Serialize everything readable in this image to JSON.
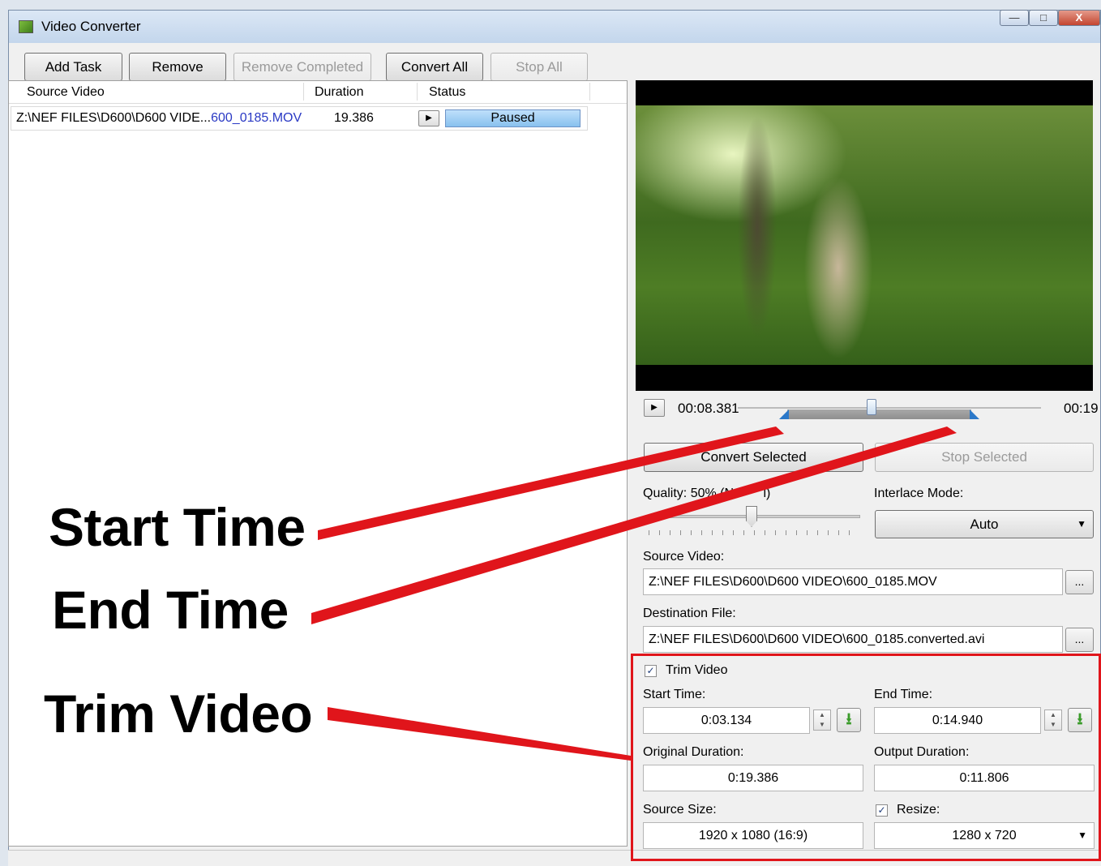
{
  "window": {
    "title": "Video Converter",
    "controls": {
      "minimize": "—",
      "maximize": "□",
      "close": "X"
    }
  },
  "toolbar": {
    "add_task": "Add Task",
    "remove": "Remove",
    "remove_completed": "Remove Completed",
    "convert_all": "Convert All",
    "stop_all": "Stop All"
  },
  "task_list": {
    "columns": [
      "Source Video",
      "Duration",
      "Status"
    ],
    "rows": [
      {
        "source_prefix": "Z:\\NEF FILES\\D600\\D600 VIDE...",
        "source_suffix": "600_0185.MOV",
        "duration": "19.386",
        "status": "Paused"
      }
    ]
  },
  "player": {
    "current_time": "00:08.381",
    "total_time": "00:19",
    "playhead_fraction": 0.44,
    "trim_start_fraction": 0.162,
    "trim_end_fraction": 0.771
  },
  "actions": {
    "convert_selected": "Convert Selected",
    "stop_selected": "Stop Selected"
  },
  "settings": {
    "quality_label": "Quality: 50% (N",
    "quality_label_tail": "l)",
    "quality_value": 0.5,
    "interlace_label": "Interlace Mode:",
    "interlace_value": "Auto",
    "source_video_label": "Source Video:",
    "source_video_value": "Z:\\NEF FILES\\D600\\D600 VIDEO\\600_0185.MOV",
    "destination_label": "Destination File:",
    "destination_value": "Z:\\NEF FILES\\D600\\D600 VIDEO\\600_0185.converted.avi",
    "browse": "..."
  },
  "trim": {
    "checkbox_label": "Trim Video",
    "checked": true,
    "start_label": "Start Time:",
    "start_value": "0:03.134",
    "end_label": "End Time:",
    "end_value": "0:14.940",
    "original_duration_label": "Original Duration:",
    "original_duration_value": "0:19.386",
    "output_duration_label": "Output Duration:",
    "output_duration_value": "0:11.806",
    "source_size_label": "Source Size:",
    "source_size_value": "1920 x 1080 (16:9)",
    "resize_label": "Resize:",
    "resize_checked": true,
    "resize_value": "1280 x 720"
  },
  "annotations": {
    "start_time": "Start Time",
    "end_time": "End Time",
    "trim_video": "Trim Video"
  },
  "colors": {
    "annotation_red": "#e0151b",
    "trim_marker_blue": "#2b78c9",
    "path_highlight": "#2a39c4"
  }
}
